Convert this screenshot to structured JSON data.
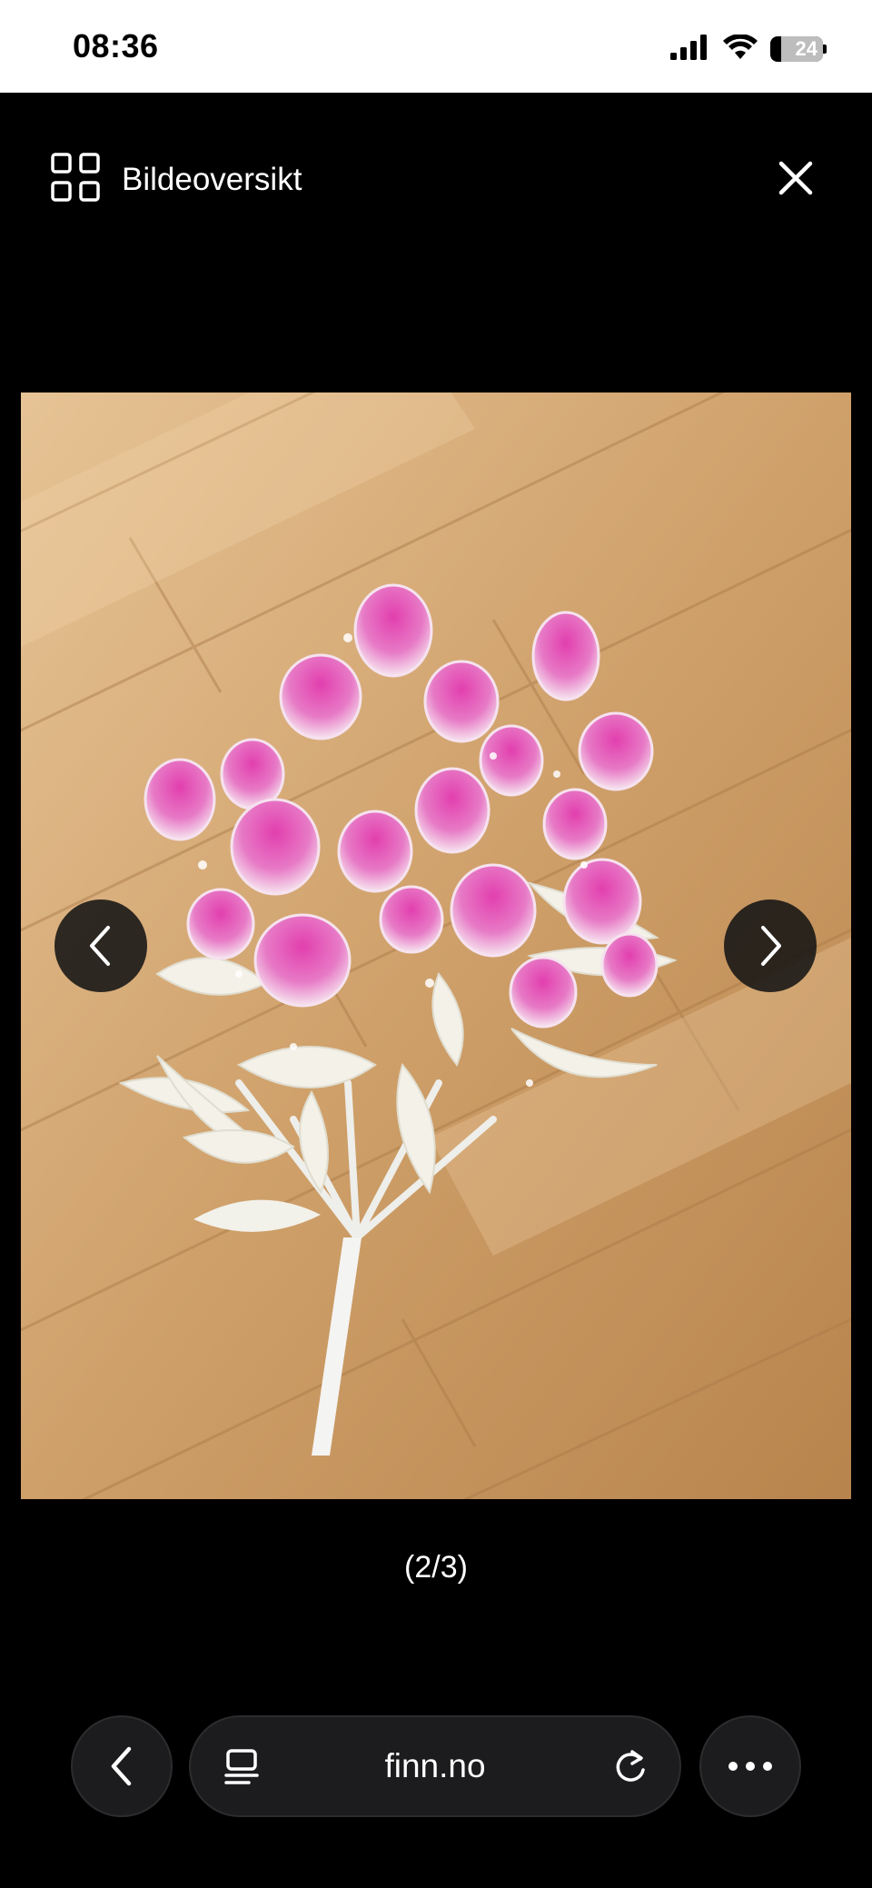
{
  "status_bar": {
    "time": "08:36",
    "battery_level": "24"
  },
  "header": {
    "overview_label": "Bildeoversikt",
    "overview_icon": "grid-icon",
    "close_icon": "close-icon"
  },
  "gallery": {
    "counter": "(2/3)",
    "prev_icon": "chevron-left-icon",
    "next_icon": "chevron-right-icon"
  },
  "browser": {
    "url": "finn.no",
    "back_icon": "chevron-left-icon",
    "reader_icon": "reader-icon",
    "reload_icon": "reload-icon",
    "more_icon": "more-icon"
  }
}
